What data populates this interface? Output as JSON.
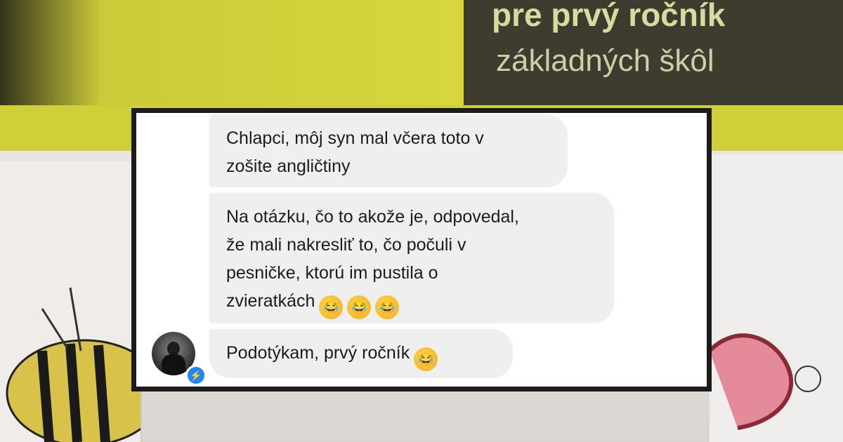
{
  "background": {
    "cover_title": "pre prvý ročník",
    "cover_subtitle": "základných škôl"
  },
  "messages": [
    {
      "text": "Chlapci, môj syn mal včera toto v\nzošite angličtiny"
    },
    {
      "text": "Na otázku, čo to akože je,  odpovedal,\nže mali nakresliť to, čo počuli v\npesničke, ktorú im pustila o\nzvieratkách",
      "emoji_count": 3
    },
    {
      "text": "Podotýkam, prvý ročník",
      "emoji_count": 1
    }
  ],
  "emoji": {
    "glyph": "😂",
    "name": "rolling-on-the-floor-laughing-emoji"
  },
  "colors": {
    "bubble": "#efefef",
    "card_border": "#1b1b1b",
    "messenger_blue": "#1e86ff"
  },
  "badge_icon": "messenger-icon"
}
